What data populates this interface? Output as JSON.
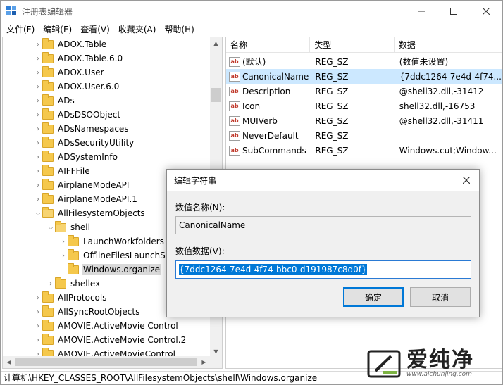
{
  "window": {
    "title": "注册表编辑器"
  },
  "menu": [
    "文件(F)",
    "编辑(E)",
    "查看(V)",
    "收藏夹(A)",
    "帮助(H)"
  ],
  "tree": {
    "items": [
      {
        "label": "ADOX.Table",
        "level": 0,
        "expandable": true
      },
      {
        "label": "ADOX.Table.6.0",
        "level": 0,
        "expandable": true
      },
      {
        "label": "ADOX.User",
        "level": 0,
        "expandable": true
      },
      {
        "label": "ADOX.User.6.0",
        "level": 0,
        "expandable": true
      },
      {
        "label": "ADs",
        "level": 0,
        "expandable": true
      },
      {
        "label": "ADsDSOObject",
        "level": 0,
        "expandable": true
      },
      {
        "label": "ADsNamespaces",
        "level": 0,
        "expandable": true
      },
      {
        "label": "ADsSecurityUtility",
        "level": 0,
        "expandable": true
      },
      {
        "label": "ADSystemInfo",
        "level": 0,
        "expandable": true
      },
      {
        "label": "AIFFFile",
        "level": 0,
        "expandable": true
      },
      {
        "label": "AirplaneModeAPI",
        "level": 0,
        "expandable": true
      },
      {
        "label": "AirplaneModeAPI.1",
        "level": 0,
        "expandable": true
      },
      {
        "label": "AllFilesystemObjects",
        "level": 0,
        "expandable": true,
        "expanded": true
      },
      {
        "label": "shell",
        "level": 1,
        "expandable": true,
        "expanded": true
      },
      {
        "label": "LaunchWorkfolders",
        "level": 2,
        "expandable": true
      },
      {
        "label": "OfflineFilesLaunchSy",
        "level": 2,
        "expandable": true
      },
      {
        "label": "Windows.organize",
        "level": 2,
        "expandable": false,
        "selected": true
      },
      {
        "label": "shellex",
        "level": 1,
        "expandable": true
      },
      {
        "label": "AllProtocols",
        "level": 0,
        "expandable": true
      },
      {
        "label": "AllSyncRootObjects",
        "level": 0,
        "expandable": true
      },
      {
        "label": "AMOVIE.ActiveMovie Control",
        "level": 0,
        "expandable": true
      },
      {
        "label": "AMOVIE.ActiveMovie Control.2",
        "level": 0,
        "expandable": true
      },
      {
        "label": "AMOVIE.ActiveMovieControl",
        "level": 0,
        "expandable": true
      }
    ]
  },
  "values": {
    "headers": {
      "name": "名称",
      "type": "类型",
      "data": "数据"
    },
    "rows": [
      {
        "name": "(默认)",
        "type": "REG_SZ",
        "data": "(数值未设置)"
      },
      {
        "name": "CanonicalName",
        "type": "REG_SZ",
        "data": "{7ddc1264-7e4d-4f74...",
        "selected": true
      },
      {
        "name": "Description",
        "type": "REG_SZ",
        "data": "@shell32.dll,-31412"
      },
      {
        "name": "Icon",
        "type": "REG_SZ",
        "data": "shell32.dll,-16753"
      },
      {
        "name": "MUIVerb",
        "type": "REG_SZ",
        "data": "@shell32.dll,-31411"
      },
      {
        "name": "NeverDefault",
        "type": "REG_SZ",
        "data": ""
      },
      {
        "name": "SubCommands",
        "type": "REG_SZ",
        "data": "Windows.cut;Window..."
      }
    ]
  },
  "status": {
    "path": "计算机\\HKEY_CLASSES_ROOT\\AllFilesystemObjects\\shell\\Windows.organize"
  },
  "dialog": {
    "title": "编辑字符串",
    "name_label": "数值名称(N):",
    "name_value": "CanonicalName",
    "data_label": "数值数据(V):",
    "data_value": "{7ddc1264-7e4d-4f74-bbc0-d191987c8d0f}",
    "ok_label": "确定",
    "cancel_label": "取消"
  },
  "watermark": {
    "brand": "爱纯净",
    "url": "www.aichunjing.com"
  },
  "colors": {
    "selection_blue": "#0078d7",
    "row_selected": "#cce8ff",
    "folder": "#f5c84c"
  }
}
